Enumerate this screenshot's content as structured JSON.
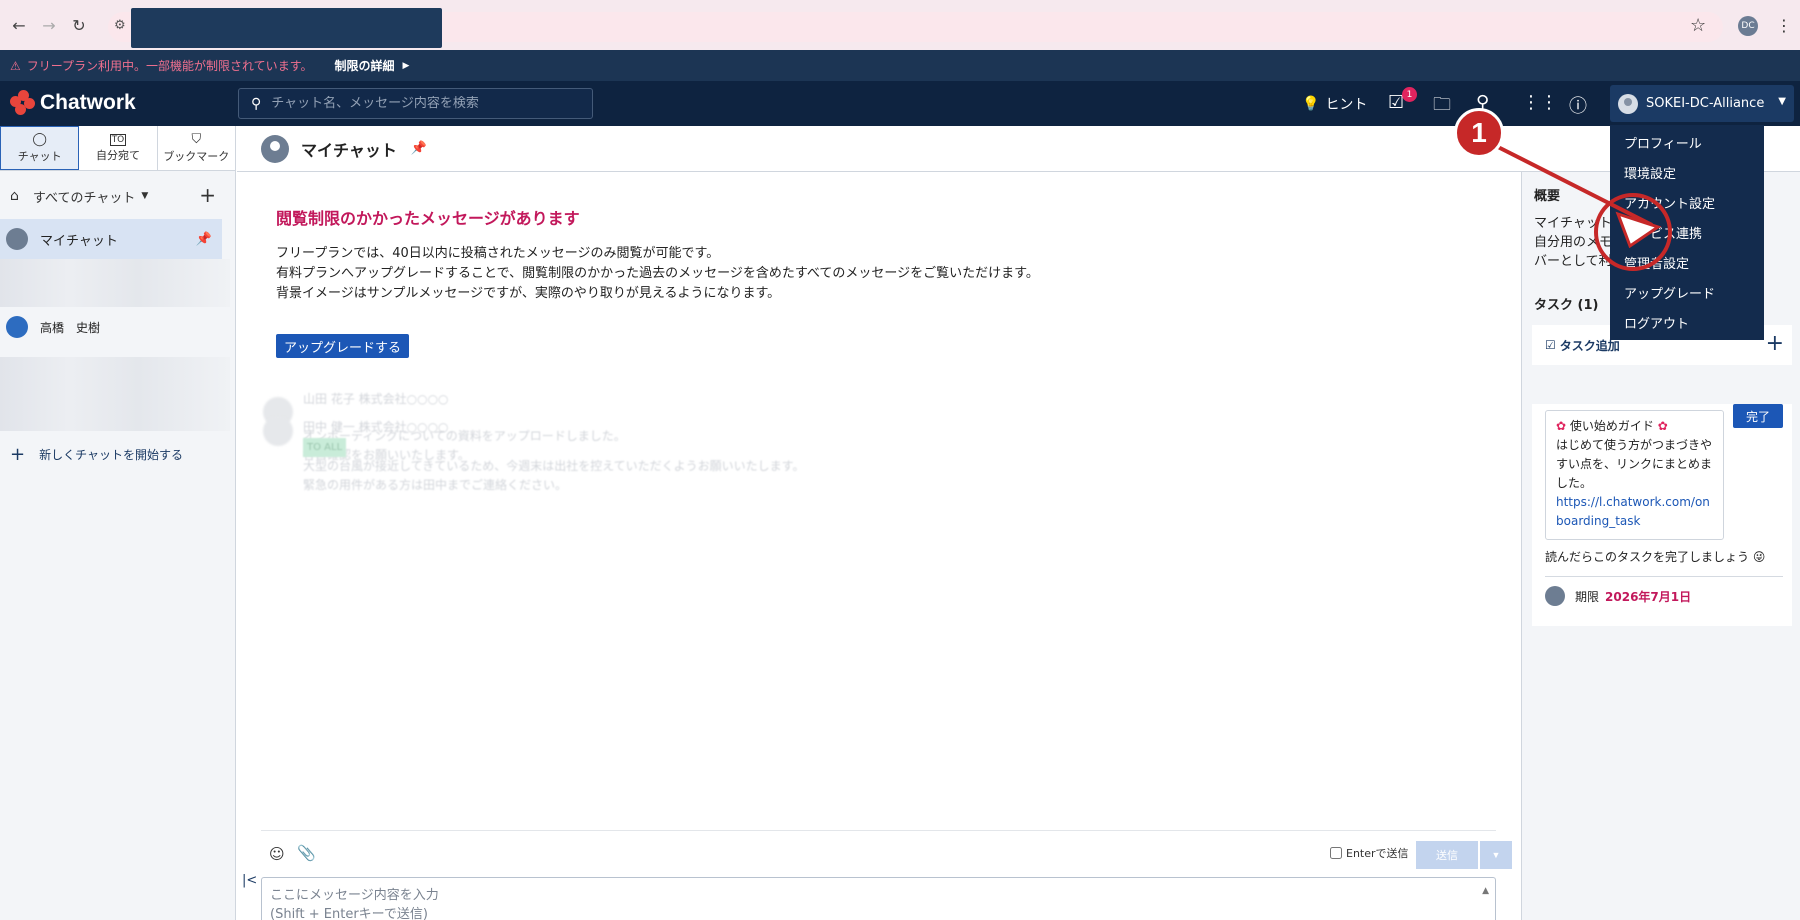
{
  "browser": {
    "back_icon": "←",
    "forward_icon": "→",
    "reload_icon": "↻",
    "site_icon": "⚙",
    "star_icon": "☆",
    "profile_initials": "DC",
    "menu_icon": "⋮"
  },
  "plan_bar": {
    "warning_icon": "⚠",
    "message": "フリープラン利用中。一部機能が制限されています。",
    "details_label": "制限の詳細",
    "details_arrow": "▶"
  },
  "header": {
    "app_name": "Chatwork",
    "search_placeholder": "チャット名、メッセージ内容を検索",
    "hint_label": "ヒント",
    "task_badge_count": "1",
    "user_name": "SOKEI-DC-Alliance",
    "caret": "▼"
  },
  "user_dropdown": {
    "items": [
      "プロフィール",
      "環境設定",
      "アカウント設定",
      "サービス連携",
      "管理者設定",
      "アップグレード",
      "ログアウト"
    ]
  },
  "left_tabs": [
    {
      "icon": "💬",
      "label": "チャット"
    },
    {
      "icon": "TO",
      "label": "自分宛て"
    },
    {
      "icon": "🔖",
      "label": "ブックマーク"
    }
  ],
  "sidebar": {
    "filter_label": "すべてのチャット",
    "filter_caret": "▼",
    "add_icon": "+",
    "rooms": [
      {
        "name": "マイチャット"
      },
      {
        "name": "高橋　史樹"
      }
    ],
    "new_chat_label": "新しくチャットを開始する",
    "collapse_icon": "|<"
  },
  "chat": {
    "title": "マイチャット",
    "pin_icon": "📌",
    "notice_title": "閲覧制限のかかったメッセージがあります",
    "notice_lines": [
      "フリープランでは、40日以内に投稿されたメッセージのみ閲覧が可能です。",
      "有料プランへアップグレードすることで、閲覧制限のかかった過去のメッセージを含めたすべてのメッセージをご覧いただけます。",
      "背景イメージはサンプルメッセージですが、実際のやり取りが見えるようになります。"
    ],
    "upgrade_button": "アップグレードする",
    "ghost_messages": [
      {
        "sender": "山田 花子 株式会社○○○○",
        "lines": [
          "オンボーディングについての資料をアップロードしました。",
          "各自確認をお願いいたします。"
        ]
      },
      {
        "sender": "田中 健一 株式会社○○○○",
        "tag": "TO ALL",
        "lines": [
          "大型の台風が接近してきているため、今週末は出社を控えていただくようお願いいたします。",
          "緊急の用件がある方は田中までご連絡ください。"
        ]
      }
    ]
  },
  "composer": {
    "emoji_icon": "☺",
    "attach_icon": "📎",
    "enter_send_label": "Enterで送信",
    "send_label": "送信",
    "send_caret": "▼",
    "placeholder_line1": "ここにメッセージ内容を入力",
    "placeholder_line2": "(Shift + Enterキーで送信)",
    "scroll_icon": "▲"
  },
  "right_panel": {
    "overview_title": "概要",
    "overview_lines": [
      "マイチャット",
      "自分用のメモ",
      "バーとして利用"
    ],
    "task_heading": "タスク (1)",
    "task_add_label": "タスク追加",
    "task_add_icon": "+",
    "guide_title": "使い始めガイド",
    "guide_text": "はじめて使う方がつまづきやすい点を、リンクにまとめました。",
    "guide_link": "https://l.chatwork.com/onboarding_task",
    "done_label": "完了",
    "guide_footer": "読んだらこのタスクを完了しましょう",
    "footer_emoji": "😜",
    "due_label": "期限",
    "due_date": "2026年7月1日"
  },
  "annotation": {
    "number": "1",
    "color": "#c62828"
  }
}
